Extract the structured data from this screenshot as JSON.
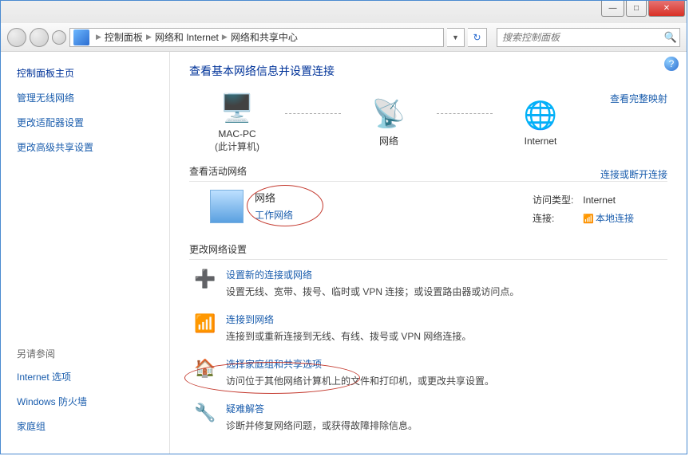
{
  "titlebar": {
    "minimize": "—",
    "maximize": "□",
    "close": "✕"
  },
  "breadcrumb": {
    "root_sep": "▶",
    "items": [
      "控制面板",
      "网络和 Internet",
      "网络和共享中心"
    ]
  },
  "search": {
    "placeholder": "搜索控制面板"
  },
  "sidebar": {
    "heading": "控制面板主页",
    "links": [
      "管理无线网络",
      "更改适配器设置",
      "更改高级共享设置"
    ],
    "see_also_heading": "另请参阅",
    "see_also_links": [
      "Internet 选项",
      "Windows 防火墙",
      "家庭组"
    ]
  },
  "main": {
    "title": "查看基本网络信息并设置连接",
    "map": {
      "computer_label": "MAC-PC",
      "computer_sub": "(此计算机)",
      "network_label": "网络",
      "internet_label": "Internet",
      "full_map_link": "查看完整映射"
    },
    "active_section": {
      "title": "查看活动网络",
      "right_link": "连接或断开连接",
      "network_name": "网络",
      "network_type": "工作网络",
      "access_label": "访问类型:",
      "access_value": "Internet",
      "conn_label": "连接:",
      "conn_value": "本地连接"
    },
    "change_title": "更改网络设置",
    "settings": [
      {
        "icon": "ic-plus",
        "title": "设置新的连接或网络",
        "desc": "设置无线、宽带、拨号、临时或 VPN 连接；或设置路由器或访问点。"
      },
      {
        "icon": "ic-connect",
        "title": "连接到网络",
        "desc": "连接到或重新连接到无线、有线、拨号或 VPN 网络连接。"
      },
      {
        "icon": "ic-home",
        "title": "选择家庭组和共享选项",
        "desc": "访问位于其他网络计算机上的文件和打印机，或更改共享设置。"
      },
      {
        "icon": "ic-trouble",
        "title": "疑难解答",
        "desc": "诊断并修复网络问题，或获得故障排除信息。"
      }
    ]
  }
}
